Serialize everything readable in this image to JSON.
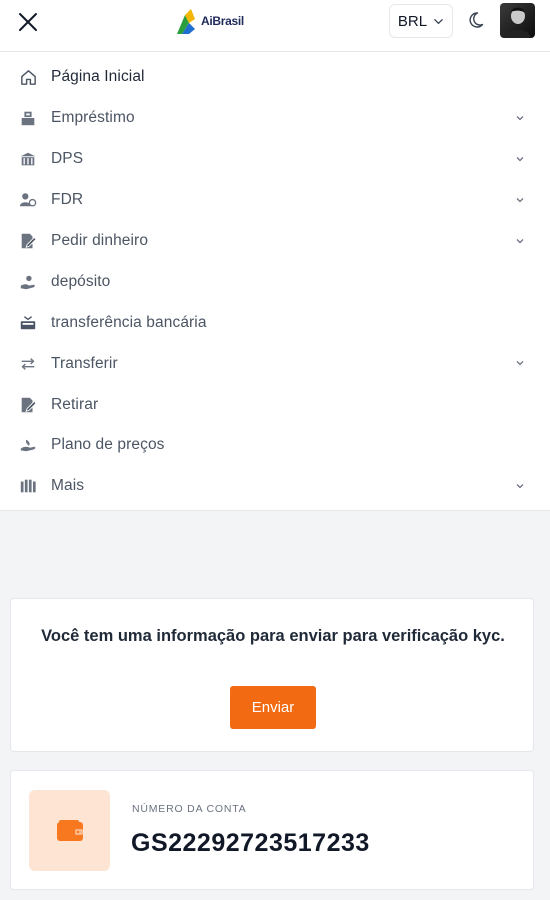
{
  "header": {
    "logo_text": "AiBrasil",
    "currency": "BRL",
    "icons": {
      "close": "close-icon",
      "moon": "moon-icon",
      "chevron": "chevron-down-icon"
    }
  },
  "menu": {
    "items": [
      {
        "label": "Página Inicial",
        "icon": "home-icon",
        "has_submenu": false
      },
      {
        "label": "Empréstimo",
        "icon": "loan-icon",
        "has_submenu": true
      },
      {
        "label": "DPS",
        "icon": "bank-icon",
        "has_submenu": true
      },
      {
        "label": "FDR",
        "icon": "user-deposit-icon",
        "has_submenu": true
      },
      {
        "label": "Pedir dinheiro",
        "icon": "request-money-icon",
        "has_submenu": true
      },
      {
        "label": "depósito",
        "icon": "deposit-icon",
        "has_submenu": false
      },
      {
        "label": "transferência bancária",
        "icon": "wire-transfer-icon",
        "has_submenu": false
      },
      {
        "label": "Transferir",
        "icon": "transfer-arrows-icon",
        "has_submenu": true
      },
      {
        "label": "Retirar",
        "icon": "withdraw-icon",
        "has_submenu": false
      },
      {
        "label": "Plano de preços",
        "icon": "pricing-plan-icon",
        "has_submenu": false
      },
      {
        "label": "Mais",
        "icon": "more-icon",
        "has_submenu": true
      }
    ]
  },
  "kyc": {
    "message": "Você tem uma informação para enviar para verificação kyc.",
    "button_label": "Enviar"
  },
  "account": {
    "label": "NÚMERO DA CONTA",
    "number": "GS22292723517233",
    "icon": "wallet-icon"
  },
  "colors": {
    "accent": "#f26a12",
    "wallet_bg": "#fde4d3",
    "icon_gray": "#6b7280"
  }
}
